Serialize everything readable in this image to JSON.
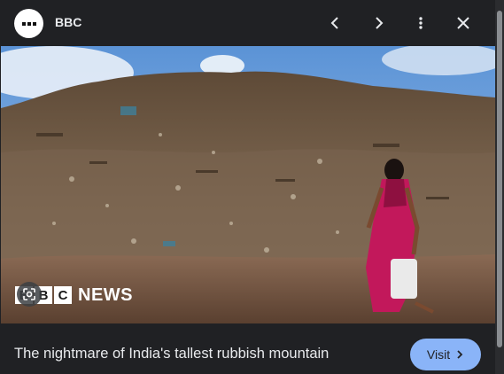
{
  "header": {
    "source_name": "BBC",
    "icons": {
      "avatar": "bbc-news-logo",
      "prev": "chevron-left-icon",
      "next": "chevron-right-icon",
      "more": "more-vert-icon",
      "close": "close-icon"
    }
  },
  "image": {
    "watermark_news": "NEWS",
    "watermark_letters": [
      "B",
      "B",
      "C"
    ],
    "lens_icon": "google-lens-icon"
  },
  "footer": {
    "caption": "The nightmare of India's tallest rubbish mountain",
    "visit_label": "Visit",
    "visit_icon": "chevron-right-icon"
  },
  "colors": {
    "background": "#202124",
    "accent_button": "#8ab4f8",
    "text": "#e8eaed"
  }
}
